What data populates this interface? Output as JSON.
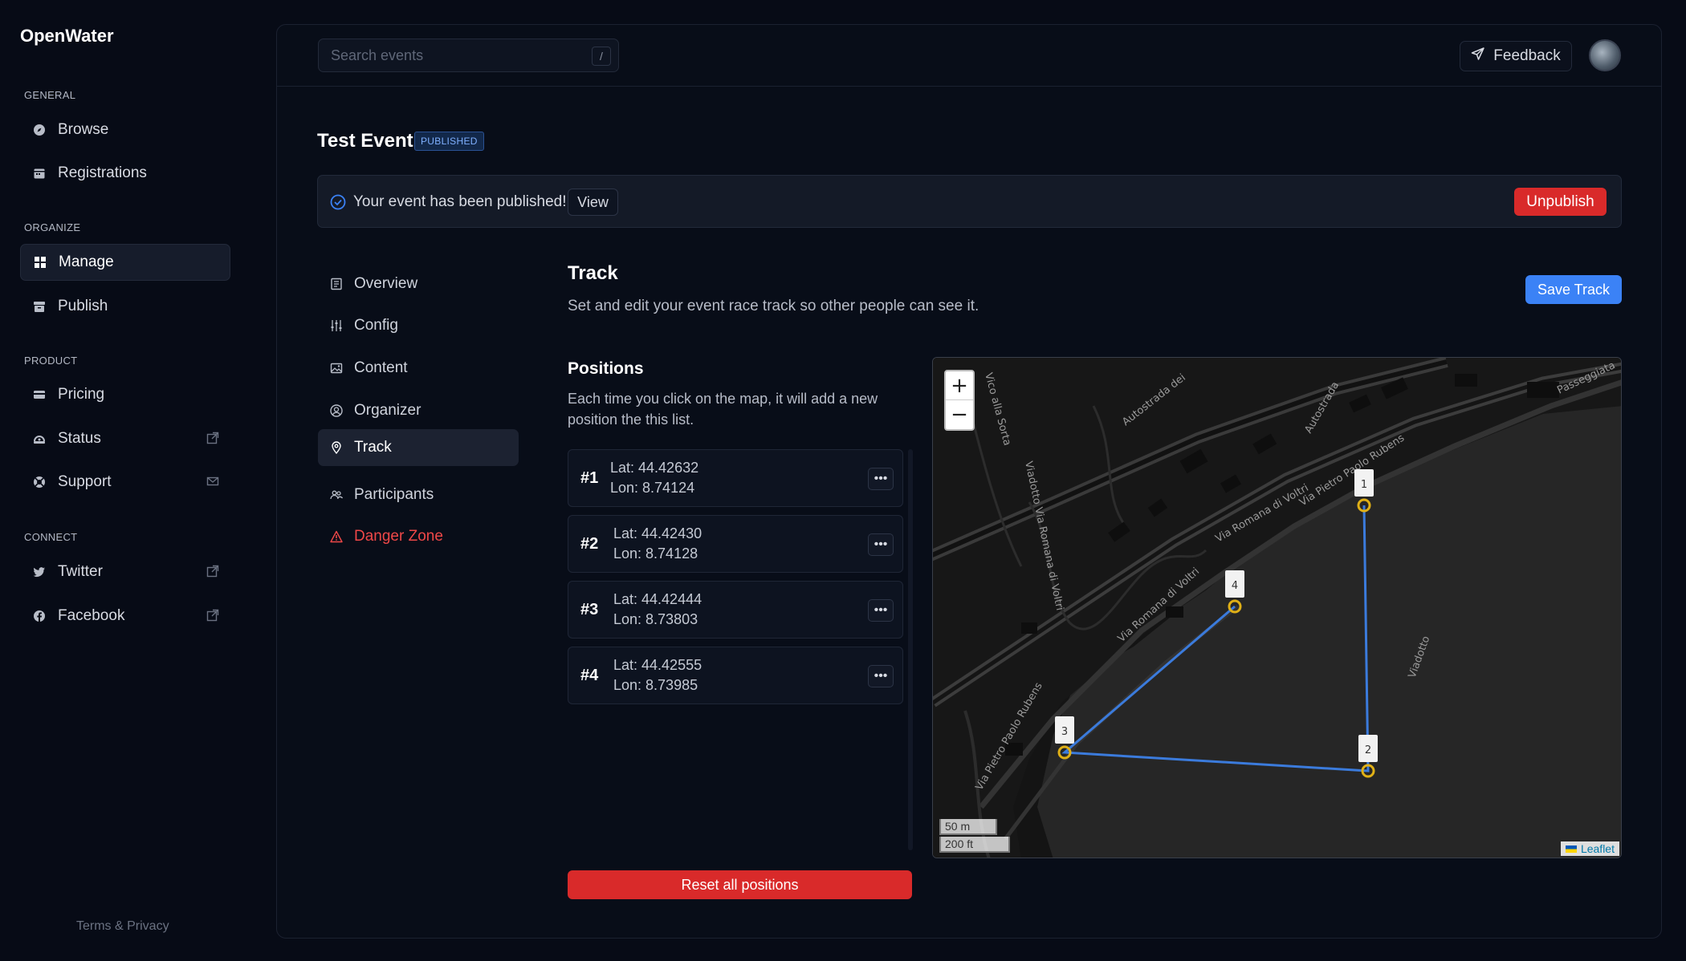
{
  "app": {
    "name": "OpenWater"
  },
  "sidebar": {
    "sections": [
      {
        "title": "GENERAL",
        "items": [
          {
            "label": "Browse",
            "icon": "compass-icon"
          },
          {
            "label": "Registrations",
            "icon": "calendar-icon"
          }
        ]
      },
      {
        "title": "ORGANIZE",
        "items": [
          {
            "label": "Manage",
            "icon": "grid-icon",
            "active": true
          },
          {
            "label": "Publish",
            "icon": "archive-icon"
          }
        ]
      },
      {
        "title": "PRODUCT",
        "items": [
          {
            "label": "Pricing",
            "icon": "credit-card-icon"
          },
          {
            "label": "Status",
            "icon": "signal-icon"
          },
          {
            "label": "Support",
            "icon": "lifebuoy-icon"
          }
        ]
      },
      {
        "title": "CONNECT",
        "items": [
          {
            "label": "Twitter",
            "icon": "twitter-icon"
          },
          {
            "label": "Facebook",
            "icon": "facebook-icon"
          }
        ]
      }
    ],
    "terms": "Terms & Privacy"
  },
  "topbar": {
    "search_placeholder": "Search events",
    "search_shortcut": "/",
    "feedback_label": "Feedback"
  },
  "event": {
    "title": "Test Event",
    "status": "PUBLISHED",
    "banner_message": "Your event has been published!",
    "view_label": "View",
    "unpublish_label": "Unpublish"
  },
  "subnav": [
    {
      "label": "Overview",
      "icon": "document-icon"
    },
    {
      "label": "Config",
      "icon": "sliders-icon"
    },
    {
      "label": "Content",
      "icon": "image-icon"
    },
    {
      "label": "Organizer",
      "icon": "user-circle-icon"
    },
    {
      "label": "Track",
      "icon": "map-pin-icon",
      "active": true
    },
    {
      "label": "Participants",
      "icon": "users-icon"
    },
    {
      "label": "Danger Zone",
      "icon": "warning-icon",
      "danger": true
    }
  ],
  "track": {
    "title": "Track",
    "description": "Set and edit your event race track so other people can see it.",
    "save_label": "Save Track",
    "positions_title": "Positions",
    "positions_description": "Each time you click on the map, it will add a new position the this list.",
    "reset_label": "Reset all positions",
    "positions": [
      {
        "num": "#1",
        "lat": "Lat: 44.42632",
        "lon": "Lon: 8.74124"
      },
      {
        "num": "#2",
        "lat": "Lat: 44.42430",
        "lon": "Lon: 8.74128"
      },
      {
        "num": "#3",
        "lat": "Lat: 44.42444",
        "lon": "Lon: 8.73803"
      },
      {
        "num": "#4",
        "lat": "Lat: 44.42555",
        "lon": "Lon: 8.73985"
      }
    ]
  },
  "map": {
    "zoom_in": "+",
    "zoom_out": "−",
    "scale_metric": "50 m",
    "scale_imperial": "200 ft",
    "attribution": "Leaflet",
    "markers": [
      {
        "label": "1"
      },
      {
        "label": "2"
      },
      {
        "label": "3"
      },
      {
        "label": "4"
      }
    ],
    "street_labels": [
      "Via Pietro Paolo Rubens",
      "Via Romana di Voltri",
      "Via Romana di Voltri",
      "Autostrada dei",
      "Autostrada",
      "Viadotto",
      "Passeggiata",
      "Via Pietro Paolo Rubens",
      "Vico alla Sorta",
      "Viadotto Via Romana di Voltri"
    ],
    "track_color": "#3b7bdc",
    "marker_ring_color": "#e0b016"
  },
  "colors": {
    "accent": "#3b82f6",
    "danger": "#d92a2a"
  }
}
